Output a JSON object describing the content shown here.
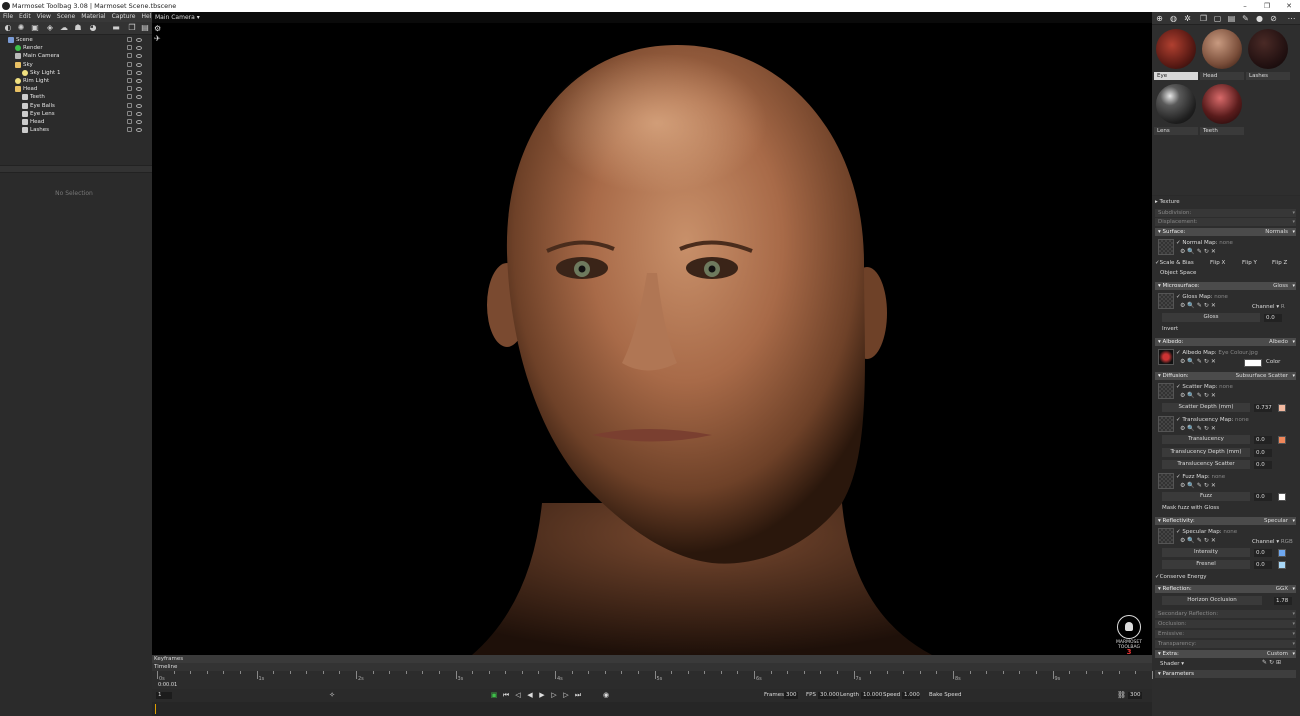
{
  "window": {
    "title": "Marmoset Toolbag 3.08  |  Marmoset Scene.tbscene",
    "controls": [
      "–",
      "❐",
      "✕"
    ]
  },
  "menu": [
    "File",
    "Edit",
    "View",
    "Scene",
    "Material",
    "Capture",
    "Help"
  ],
  "outliner": {
    "items": [
      {
        "label": "Scene",
        "icon": "scene-icon",
        "color": "#7a9bd6"
      },
      {
        "label": "Render",
        "icon": "render-icon",
        "color": "#3fc14a"
      },
      {
        "label": "Main Camera",
        "icon": "camera-icon",
        "color": "#bbbbbb"
      },
      {
        "label": "Sky",
        "icon": "folder-icon",
        "color": "#e8c064"
      },
      {
        "label": "Sky Light 1",
        "icon": "light-icon",
        "color": "#f0e080"
      },
      {
        "label": "Rim Light",
        "icon": "light-icon",
        "color": "#f0e080"
      },
      {
        "label": "Head",
        "icon": "folder-icon",
        "color": "#e8c064"
      },
      {
        "label": "Teeth",
        "icon": "mesh-icon",
        "color": "#cccccc"
      },
      {
        "label": "Eye Balls",
        "icon": "mesh-icon",
        "color": "#cccccc"
      },
      {
        "label": "Eye Lens",
        "icon": "mesh-icon",
        "color": "#cccccc"
      },
      {
        "label": "Head",
        "icon": "mesh-icon",
        "color": "#cccccc"
      },
      {
        "label": "Lashes",
        "icon": "mesh-icon",
        "color": "#cccccc"
      }
    ]
  },
  "properties": {
    "empty": "No Selection"
  },
  "viewport": {
    "camera": "Main Camera",
    "logo_text": "MARMOSET TOOLBAG",
    "logo_number": "3"
  },
  "materials": [
    {
      "name": "Eye",
      "selected": true
    },
    {
      "name": "Head",
      "selected": false
    },
    {
      "name": "Lashes",
      "selected": false
    },
    {
      "name": "Lens",
      "selected": false
    },
    {
      "name": "Teeth",
      "selected": false
    }
  ],
  "matprops": {
    "texture": "Texture",
    "subdivision": "Subdivision:",
    "displacement": "Displacement:",
    "surface": {
      "label": "Surface:",
      "value": "Normals"
    },
    "normal_map": "Normal Map:",
    "none": "none",
    "scale_bias": "Scale & Bias",
    "flip_x": "Flip X",
    "flip_y": "Flip Y",
    "flip_z": "Flip Z",
    "object_space": "Object Space",
    "microsurface": {
      "label": "Microsurface:",
      "value": "Gloss"
    },
    "gloss_map": "Gloss Map:",
    "channel": "Channel",
    "channel_r": "R",
    "gloss": {
      "label": "Gloss",
      "value": "0.0"
    },
    "invert": "Invert",
    "albedo": {
      "label": "Albedo:",
      "value": "Albedo"
    },
    "albedo_map": "Albedo Map:",
    "albedo_file": "Eye Colour.jpg",
    "color": "Color",
    "diffusion": {
      "label": "Diffusion:",
      "value": "Subsurface Scatter"
    },
    "scatter_map": "Scatter Map:",
    "scatter_depth": {
      "label": "Scatter Depth (mm)",
      "value": "0.737",
      "color": "#f3b9a0"
    },
    "translucency_map": "Translucency Map:",
    "translucency": {
      "label": "Translucency",
      "value": "0.0",
      "color": "#f0875a"
    },
    "translucency_depth": {
      "label": "Translucency Depth (mm)",
      "value": "0.0"
    },
    "translucency_scatter": {
      "label": "Translucency Scatter",
      "value": "0.0"
    },
    "fuzz_map": "Fuzz Map:",
    "fuzz": {
      "label": "Fuzz",
      "value": "0.0",
      "color": "#ffffff"
    },
    "mask_fuzz": "Mask fuzz with Gloss",
    "reflectivity": {
      "label": "Reflectivity:",
      "value": "Specular"
    },
    "specular_map": "Specular Map:",
    "channel_rgb": "RGB",
    "intensity": {
      "label": "Intensity",
      "value": "0.0",
      "color": "#6ea8f0"
    },
    "fresnel": {
      "label": "Fresnel",
      "value": "0.0",
      "color": "#a8d8f8"
    },
    "conserve": "Conserve Energy",
    "reflection": {
      "label": "Reflection:",
      "value": "GGX"
    },
    "horizon": {
      "label": "Horizon Occlusion",
      "value": "1.78"
    },
    "secondary": "Secondary Reflection:",
    "occlusion": "Occlusion:",
    "emissive": "Emissive:",
    "transparency": "Transparency:",
    "extra": {
      "label": "Extra:",
      "value": "Custom"
    },
    "shader": "Shader",
    "parameters": "Parameters"
  },
  "timeline": {
    "keyframes": "Keyframes",
    "timeline": "Timeline",
    "ticks": [
      "0s",
      "1s",
      "2s",
      "3s",
      "4s",
      "5s",
      "6s",
      "7s",
      "8s",
      "9s"
    ],
    "current_time": "0:00.01",
    "frame": "1",
    "frames_label": "Frames",
    "frames": "300",
    "fps_label": "FPS",
    "fps": "30.000",
    "length_label": "Length",
    "length": "10.000",
    "speed_label": "Speed",
    "speed": "1.000",
    "bake_speed": "Bake Speed",
    "end": "300"
  },
  "colors": {
    "accent_green": "#3fc14a",
    "panel": "#2b2b2b",
    "header": "#4b4b4b"
  }
}
